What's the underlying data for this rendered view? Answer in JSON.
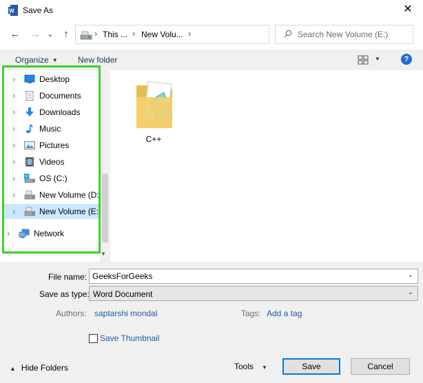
{
  "window": {
    "title": "Save As",
    "close_glyph": "✕",
    "app_icon": "word-icon"
  },
  "nav": {
    "back_glyph": "←",
    "forward_glyph": "→",
    "recent_glyph": "⌄",
    "up_glyph": "↑",
    "breadcrumb": [
      "This ...",
      "New Volu..."
    ],
    "crumb_separator": "›",
    "dropdown_glyph": "⌄",
    "refresh_glyph": "↻"
  },
  "search": {
    "placeholder": "Search New Volume (E:)",
    "icon": "search-icon"
  },
  "toolbar": {
    "organize_label": "Organize",
    "new_folder_label": "New folder",
    "caret": "▼",
    "help_label": "?"
  },
  "sidebar": {
    "items": [
      {
        "label": "Desktop",
        "icon": "desktop-icon"
      },
      {
        "label": "Documents",
        "icon": "documents-icon"
      },
      {
        "label": "Downloads",
        "icon": "downloads-icon"
      },
      {
        "label": "Music",
        "icon": "music-icon"
      },
      {
        "label": "Pictures",
        "icon": "pictures-icon"
      },
      {
        "label": "Videos",
        "icon": "videos-icon"
      },
      {
        "label": "OS (C:)",
        "icon": "os-drive-icon"
      },
      {
        "label": "New Volume (D:",
        "icon": "drive-d-icon"
      },
      {
        "label": "New Volume (E:)",
        "icon": "drive-e-icon",
        "selected": true
      },
      {
        "label": "Network",
        "icon": "network-icon"
      }
    ],
    "chevron": "›",
    "highlight_color": "#3bd12a"
  },
  "files": [
    {
      "name": "C++",
      "icon": "folder-icon"
    }
  ],
  "form": {
    "file_name_label": "File name:",
    "file_name_value": "GeeksForGeeks",
    "save_as_type_label": "Save as type:",
    "save_as_type_value": "Word Document",
    "authors_label": "Authors:",
    "authors_value": "saptarshi mondal",
    "tags_label": "Tags:",
    "tags_value": "Add a tag",
    "save_thumbnail_label": "Save Thumbnail",
    "combo_caret": "⌄"
  },
  "footer": {
    "hide_folders_label": "Hide Folders",
    "hide_caret": "▲",
    "tools_label": "Tools",
    "tools_caret": "▼",
    "save_label": "Save",
    "cancel_label": "Cancel"
  },
  "colors": {
    "accent": "#0078d7",
    "link": "#1f5aa8",
    "selection": "#cce8ff"
  }
}
